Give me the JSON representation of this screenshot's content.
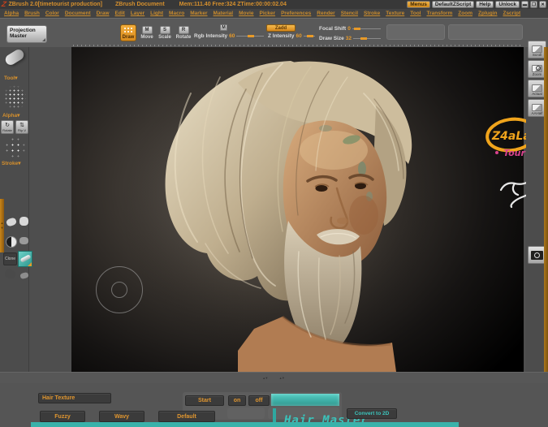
{
  "title_bar": {
    "app_title": "ZBrush 2.0[timetourist production]",
    "doc_title": "ZBrush Document",
    "stats": "Mem:111.40 Free:324 ZTime:00:00:02.04",
    "menus": "Menus",
    "default_zscript": "DefaultZScript",
    "help": "Help",
    "unlock": "Unlock",
    "minimize_glyph": "▬",
    "restore_glyph": "❐",
    "close_glyph": "✕"
  },
  "menu_bar": {
    "items": [
      "Alpha",
      "Brush",
      "Color",
      "Document",
      "Draw",
      "Edit",
      "Layer",
      "Light",
      "Macro",
      "Marker",
      "Material",
      "Movie",
      "Picker",
      "Preferences",
      "Render",
      "Stencil",
      "Stroke",
      "Texture",
      "Tool",
      "Transform",
      "Zoom",
      "Zplugin",
      "Zscript"
    ]
  },
  "shelf": {
    "projection_master": "Projection Master",
    "draw": "Draw",
    "move": "Move",
    "scale": "Scale",
    "rotate": "Rotate",
    "move_icon_letter": "M",
    "scale_icon_letter": "S",
    "rotate_icon_letter": "R",
    "m_toggle": "M",
    "zadd": "Zadd",
    "rgb_intensity_label": "Rgb Intensity",
    "rgb_intensity_value": "60",
    "z_intensity_label": "Z Intensity",
    "z_intensity_value": "60",
    "focal_shift_label": "Focal Shift",
    "focal_shift_value": "0",
    "draw_size_label": "Draw Size",
    "draw_size_value": "32"
  },
  "left_dock": {
    "tool_label": "Tool",
    "alpha_label": "Alpha",
    "stroke_label": "Stroke",
    "dropdown_glyph": "▾",
    "rotate_button": "Rotate",
    "flip_button": "Flip V",
    "rotate_glyph": "↻",
    "flip_glyph": "⇅",
    "clone_button": "Clone"
  },
  "right_dock": {
    "scroll": "Scroll",
    "zoom": "Zoom",
    "actual": "Actual",
    "aahalf": "AAHalf"
  },
  "canvas": {
    "watermark_line1": "Z4aLa",
    "watermark_line2": "Tour"
  },
  "colors": {
    "accent_orange": "#e89a28",
    "teal": "#39b2aa"
  },
  "bottom_panel": {
    "hair_texture": "Hair Texture",
    "fuzzy": "Fuzzy",
    "wavy": "Wavy",
    "default": "Default",
    "start": "Start",
    "on": "on",
    "off": "off",
    "convert_to_2d": "Convert to 2D",
    "plugin_title": "Hair Master"
  }
}
